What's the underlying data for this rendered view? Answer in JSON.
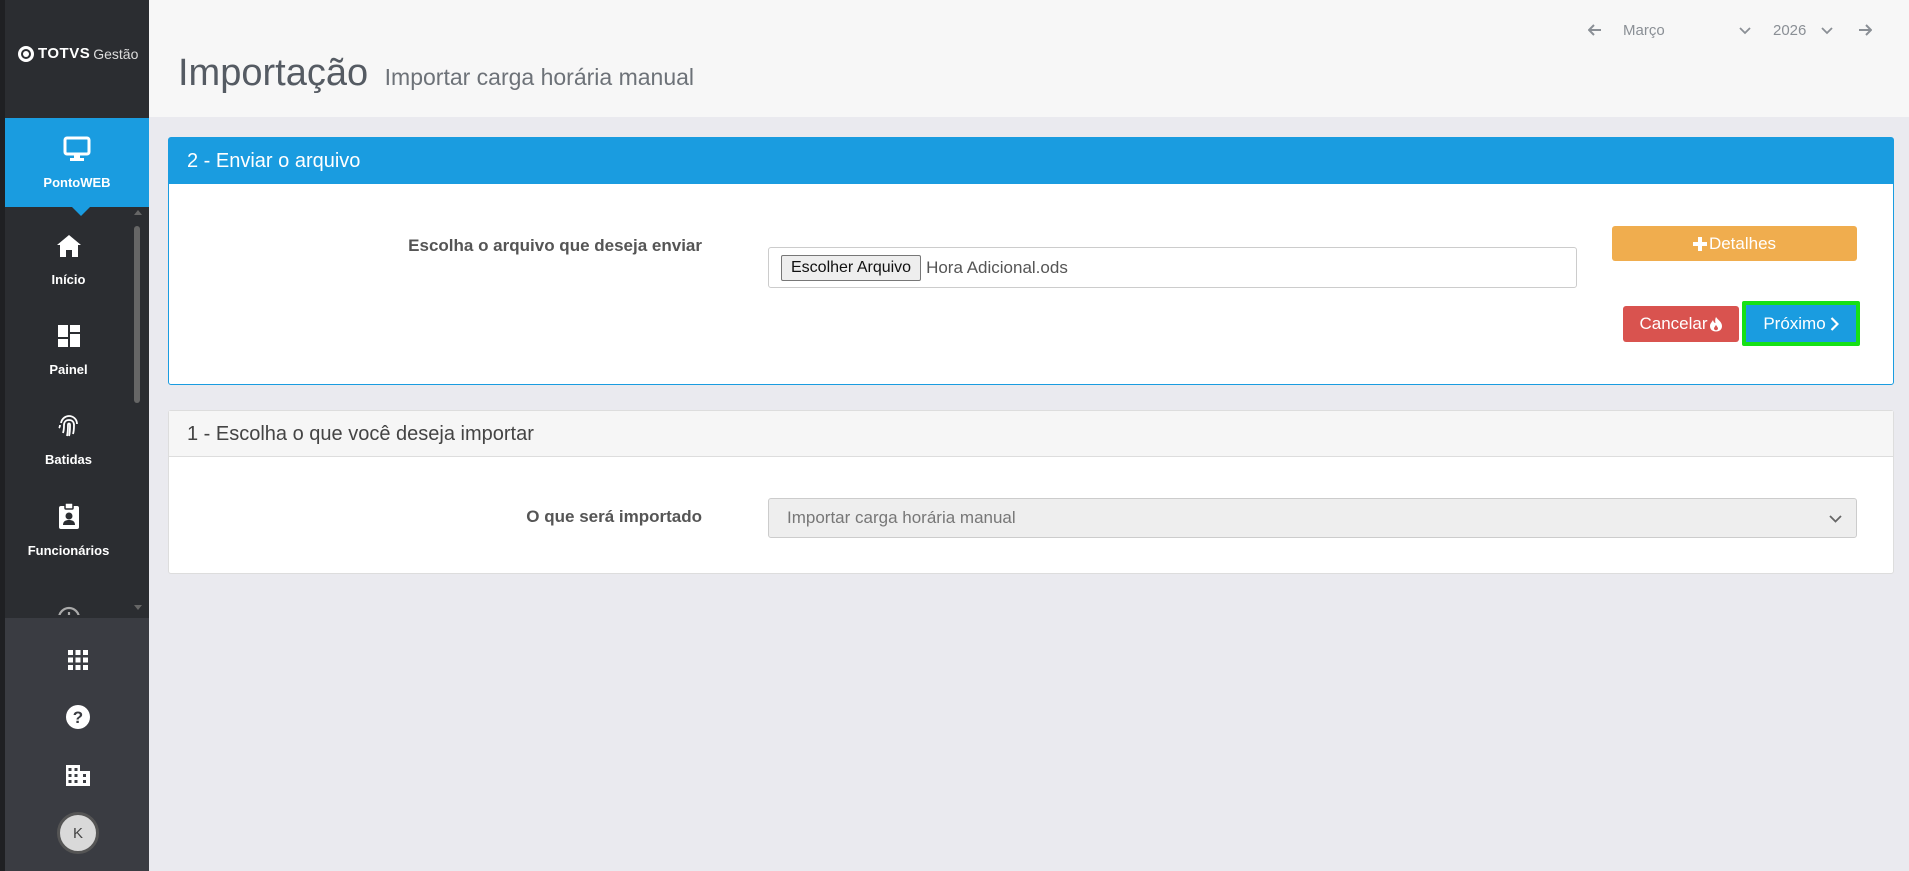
{
  "app": {
    "logo_bold": "TOTVS",
    "logo_light": "Gestão"
  },
  "sidebar": {
    "active": {
      "label": "PontoWEB",
      "icon": "monitor-icon"
    },
    "items": [
      {
        "label": "Início",
        "icon": "home-icon"
      },
      {
        "label": "Painel",
        "icon": "dashboard-icon"
      },
      {
        "label": "Batidas",
        "icon": "fingerprint-icon"
      },
      {
        "label": "Funcionários",
        "icon": "badge-icon"
      },
      {
        "label": "",
        "icon": "clock-icon"
      }
    ],
    "bottom": [
      {
        "icon": "apps-grid-icon"
      },
      {
        "icon": "help-icon"
      },
      {
        "icon": "building-icon"
      }
    ],
    "avatar_initial": "K"
  },
  "header": {
    "title": "Importação",
    "subtitle": "Importar carga horária manual",
    "month": "Março",
    "year": "2026"
  },
  "panel_send": {
    "title": "2 - Enviar o arquivo",
    "file_label": "Escolha o arquivo que deseja enviar",
    "file_button": "Escolher Arquivo",
    "file_name": "Hora Adicional.ods",
    "details_label": "Detalhes",
    "cancel_label": "Cancelar",
    "next_label": "Próximo"
  },
  "panel_choose": {
    "title": "1 - Escolha o que você deseja importar",
    "import_label": "O que será importado",
    "import_value": "Importar carga horária manual"
  },
  "colors": {
    "primary": "#1a9ce0",
    "warning": "#f0ad4e",
    "danger": "#d9534f",
    "highlight": "#16e016",
    "sidebar": "#2b2d31"
  }
}
